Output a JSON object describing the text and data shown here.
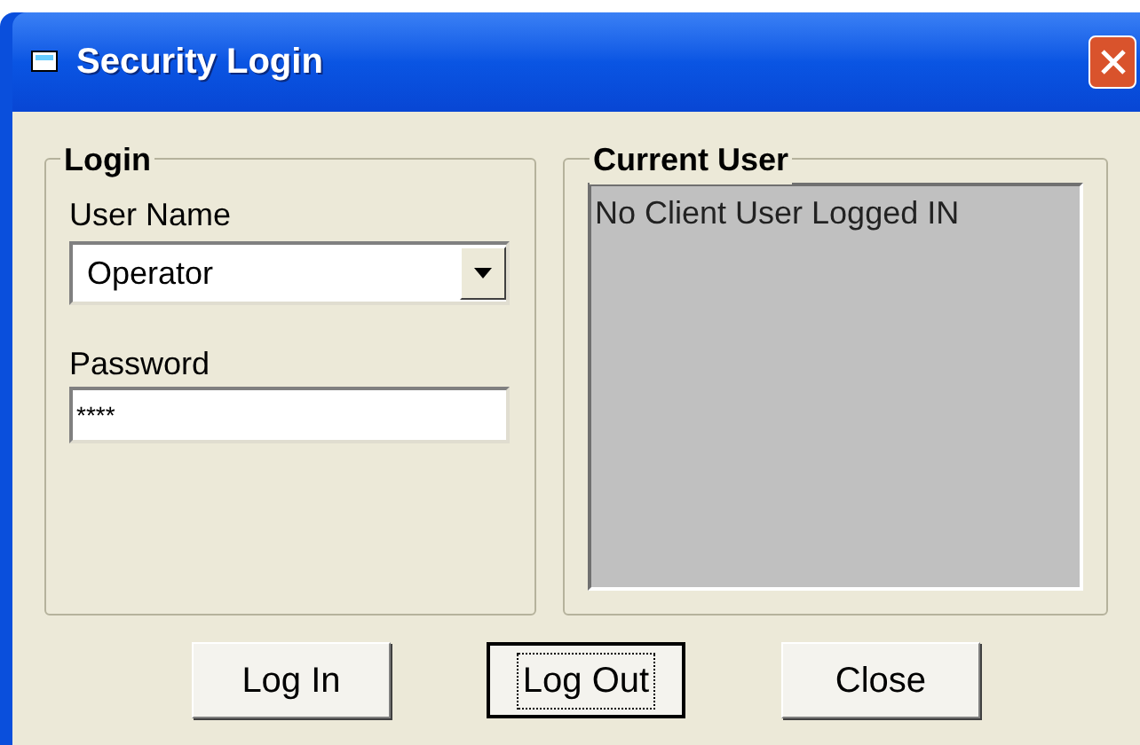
{
  "window": {
    "title": "Security Login"
  },
  "login": {
    "title": "Login",
    "user_name_label": "User Name",
    "user_name_value": "Operator",
    "password_label": "Password",
    "password_value": "****"
  },
  "current_user": {
    "title": "Current User",
    "text": "No Client User Logged IN"
  },
  "buttons": [
    {
      "label": "Log In",
      "focused": false
    },
    {
      "label": "Log Out",
      "focused": true
    },
    {
      "label": "Close",
      "focused": false
    }
  ]
}
